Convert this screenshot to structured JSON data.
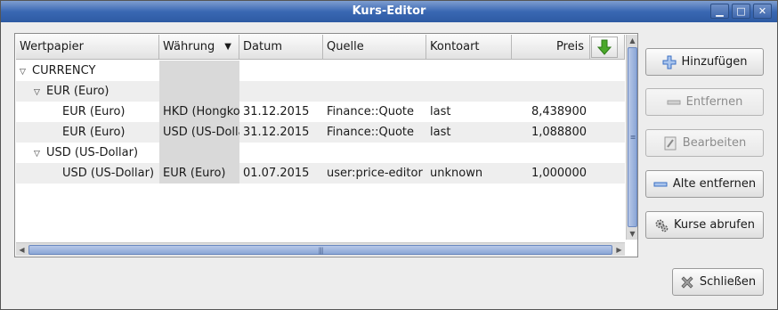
{
  "window": {
    "title": "Kurs-Editor",
    "controls": {
      "minimize": "▁",
      "maximize": "□",
      "close": "✕"
    }
  },
  "table": {
    "columns": [
      "Wertpapier",
      "Währung",
      "Datum",
      "Quelle",
      "Kontoart",
      "Preis"
    ],
    "sort_indicator": "▼",
    "rows": [
      {
        "wertpapier": "CURRENCY",
        "waehrung": "",
        "datum": "",
        "quelle": "",
        "kontoart": "",
        "preis": ""
      },
      {
        "wertpapier": "EUR (Euro)",
        "waehrung": "",
        "datum": "",
        "quelle": "",
        "kontoart": "",
        "preis": ""
      },
      {
        "wertpapier": "EUR (Euro)",
        "waehrung": "HKD (Hongkong-Dollar)",
        "datum": "31.12.2015",
        "quelle": "Finance::Quote",
        "kontoart": "last",
        "preis": "8,438900"
      },
      {
        "wertpapier": "EUR (Euro)",
        "waehrung": "USD (US-Dollar)",
        "datum": "31.12.2015",
        "quelle": "Finance::Quote",
        "kontoart": "last",
        "preis": "1,088800"
      },
      {
        "wertpapier": "USD (US-Dollar)",
        "waehrung": "",
        "datum": "",
        "quelle": "",
        "kontoart": "",
        "preis": ""
      },
      {
        "wertpapier": "USD (US-Dollar)",
        "waehrung": "EUR (Euro)",
        "datum": "01.07.2015",
        "quelle": "user:price-editor",
        "kontoart": "unknown",
        "preis": "1,000000"
      }
    ]
  },
  "buttons": {
    "add": "Hinzufügen",
    "remove": "Entfernen",
    "edit": "Bearbeiten",
    "remove_old": "Alte entfernen",
    "fetch": "Kurse abrufen",
    "close": "Schließen"
  },
  "colors": {
    "titlebar": "#3a68b3",
    "accent_green": "#4aa82a",
    "accent_blue": "#3a6fc4"
  }
}
